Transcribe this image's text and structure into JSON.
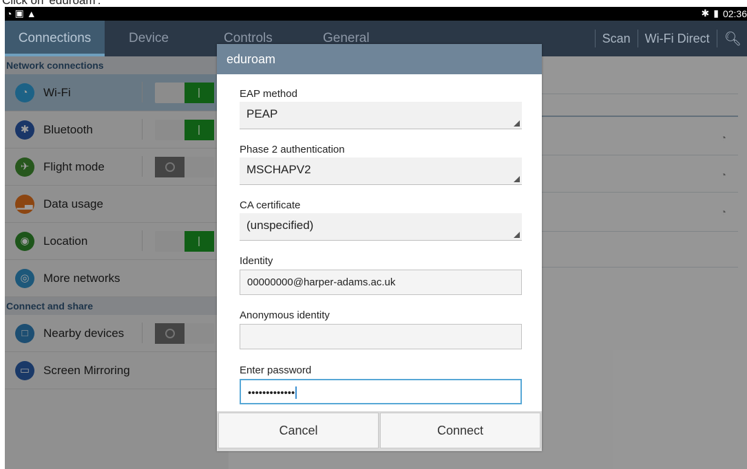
{
  "caption": "Click on 'eduroam'.",
  "status_bar": {
    "time": "02:36",
    "bluetooth_icon": "bluetooth-icon",
    "battery_icon": "battery-icon",
    "left_icons": [
      "wifi-icon",
      "image-icon",
      "warning-icon"
    ]
  },
  "tabs": [
    {
      "label": "Connections"
    },
    {
      "label": "Device"
    },
    {
      "label": "Controls"
    },
    {
      "label": "General"
    }
  ],
  "actions": {
    "scan": "Scan",
    "wifi_direct": "Wi-Fi Direct"
  },
  "sections": {
    "network": "Network connections",
    "connect": "Connect and share"
  },
  "items": {
    "wifi": {
      "label": "Wi-Fi",
      "color": "#2f9fd8",
      "toggle": "on"
    },
    "bluetooth": {
      "label": "Bluetooth",
      "color": "#2b57a8",
      "toggle": "on"
    },
    "flight": {
      "label": "Flight mode",
      "color": "#3f8d2f",
      "toggle": "off"
    },
    "data": {
      "label": "Data usage",
      "color": "#e2711d"
    },
    "location": {
      "label": "Location",
      "color": "#2f8a2a",
      "toggle": "on"
    },
    "more": {
      "label": "More networks",
      "color": "#2f8ec5"
    },
    "nearby": {
      "label": "Nearby devices",
      "color": "#2f7fb8",
      "toggle": "off"
    },
    "mirroring": {
      "label": "Screen Mirroring",
      "color": "#2b5ca8"
    }
  },
  "dialog": {
    "title": "eduroam",
    "eap_label": "EAP method",
    "eap_value": "PEAP",
    "phase2_label": "Phase 2 authentication",
    "phase2_value": "MSCHAPV2",
    "ca_label": "CA certificate",
    "ca_value": "(unspecified)",
    "identity_label": "Identity",
    "identity_value": "00000000@harper-adams.ac.uk",
    "anon_label": "Anonymous identity",
    "anon_value": "",
    "password_label": "Enter password",
    "password_value": "•••••••••••••",
    "cancel": "Cancel",
    "connect": "Connect"
  }
}
